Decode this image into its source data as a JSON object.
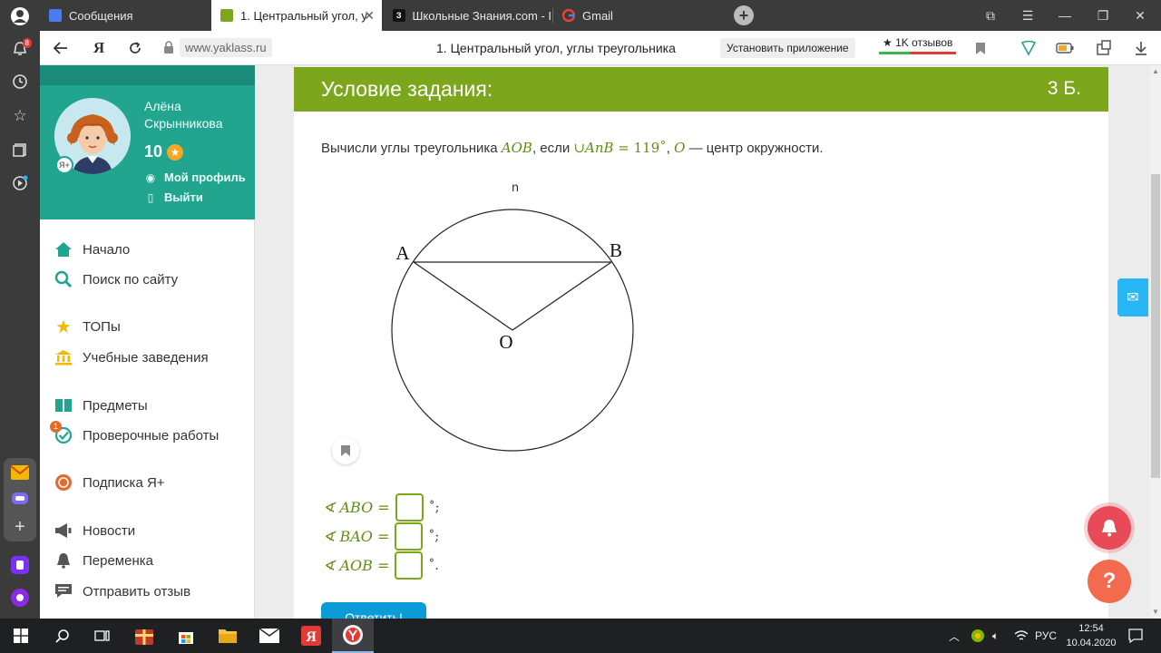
{
  "tabs": [
    {
      "label": "Сообщения",
      "active": false
    },
    {
      "label": "1. Центральный угол, у",
      "active": true
    },
    {
      "label": "Школьные Знания.com - I",
      "active": false
    },
    {
      "label": "Gmail",
      "active": false
    }
  ],
  "rail": {
    "notif_badge": "8"
  },
  "address": {
    "domain": "www.yaklass.ru",
    "page_title": "1. Центральный угол, углы треугольника",
    "install_label": "Установить приложение",
    "reviews_label": "★ 1K отзывов",
    "yandex_letter": "Я"
  },
  "profile": {
    "name_line1": "Алёна",
    "name_line2": "Скрынникова",
    "score": "10",
    "my_profile": "Мой профиль",
    "logout": "Выйти",
    "yplus_badge": "Я+"
  },
  "menu": [
    {
      "label": "Начало"
    },
    {
      "label": "Поиск по сайту"
    },
    {
      "label": "ТОПы"
    },
    {
      "label": "Учебные заведения"
    },
    {
      "label": "Предметы"
    },
    {
      "label": "Проверочные работы",
      "badge": "1"
    },
    {
      "label": "Подписка Я+"
    },
    {
      "label": "Новости"
    },
    {
      "label": "Переменка"
    },
    {
      "label": "Отправить отзыв"
    }
  ],
  "task": {
    "header_title": "Условие задания:",
    "points": "3 Б.",
    "q_text1": "Вычисли углы треугольника ",
    "q_math1": "AOB",
    "q_text2": ", если ",
    "q_math2": "∪AnB",
    "q_math3": " = 119˚",
    "q_text3": ", ",
    "q_math4": "O",
    "q_text4": " — центр окружности.",
    "diagram_labels": {
      "n": "n",
      "A": "A",
      "B": "B",
      "O": "O"
    },
    "answers": [
      {
        "label": "∢ ABO =",
        "tail": "˚;"
      },
      {
        "label": "∢ BAO =",
        "tail": "˚;"
      },
      {
        "label": "∢ AOB =",
        "tail": "˚."
      }
    ],
    "submit_label": "Ответить!"
  },
  "taskbar": {
    "lang": "РУС",
    "time": "12:54",
    "date": "10.04.2020"
  },
  "colors": {
    "header_green": "#7ca71d",
    "profile_teal": "#22a58f",
    "submit_blue": "#0b9bd7",
    "bell_red": "#e84a57",
    "help_orange": "#f26b4e"
  }
}
